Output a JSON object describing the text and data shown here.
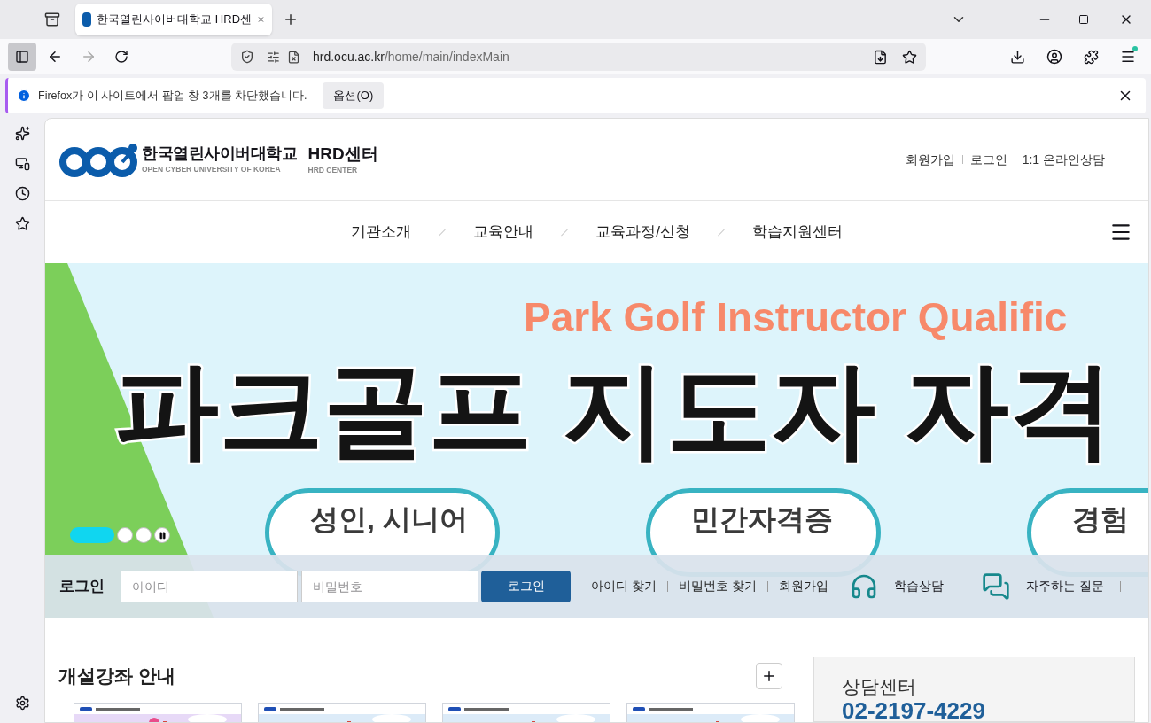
{
  "browser": {
    "tab": {
      "title": "한국열린사이버대학교 HRD센",
      "selected": true
    },
    "url": {
      "host": "hrd.ocu.ac.kr",
      "path": "/home/main/indexMain"
    },
    "notification": {
      "message": "Firefox가 이 사이트에서 팝업 창 3개를 차단했습니다.",
      "button": "옵션(O)"
    }
  },
  "header": {
    "logo": {
      "name": "한국열린사이버대학교",
      "name_en": "OPEN CYBER UNIVERSITY OF KOREA",
      "center": "HRD센터",
      "center_en": "HRD CENTER"
    },
    "top_links": [
      "회원가입",
      "로그인",
      "1:1 온라인상담"
    ]
  },
  "nav": {
    "items": [
      "기관소개",
      "교육안내",
      "교육과정/신청",
      "학습지원센터"
    ]
  },
  "banner": {
    "subtitle": "Park Golf Instructor Qualific",
    "title": "파크골프 지도자 자격",
    "pills": [
      "성인, 시니어",
      "민간자격증",
      "경험"
    ],
    "slides": [
      {
        "selected": true
      },
      {
        "selected": false
      },
      {
        "selected": false
      }
    ]
  },
  "login_bar": {
    "label": "로그인",
    "id_placeholder": "아이디",
    "pw_placeholder": "비밀번호",
    "button": "로그인",
    "links": [
      "아이디 찾기",
      "비밀번호 찾기",
      "회원가입"
    ],
    "quick": [
      {
        "kind": "headset",
        "label": "학습상담"
      },
      {
        "kind": "chat",
        "label": "자주하는 질문"
      }
    ]
  },
  "courses": {
    "title": "개설강좌 안내"
  },
  "consult": {
    "title": "상담센터",
    "phone": "02-2197-4229"
  }
}
